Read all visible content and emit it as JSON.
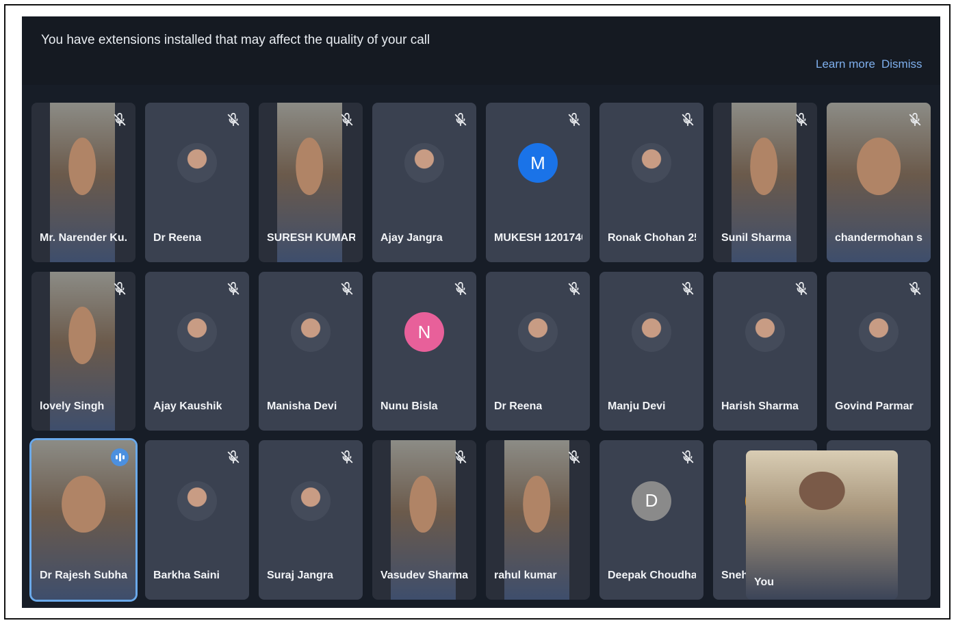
{
  "banner": {
    "message": "You have extensions installed that may affect the quality of your call",
    "learn_more": "Learn more",
    "dismiss": "Dismiss"
  },
  "participants": [
    {
      "name": "Mr. Narender Ku...",
      "type": "video"
    },
    {
      "name": "Dr Reena",
      "type": "photo"
    },
    {
      "name": "SURESH KUMAR",
      "type": "video"
    },
    {
      "name": "Ajay Jangra",
      "type": "photo"
    },
    {
      "name": "MUKESH 1201740...",
      "type": "initial",
      "initial": "M",
      "color": "#1a73e8"
    },
    {
      "name": "Ronak Chohan 25...",
      "type": "photo"
    },
    {
      "name": "Sunil Sharma",
      "type": "video"
    },
    {
      "name": "chandermohan s...",
      "type": "video"
    },
    {
      "name": "lovely Singh",
      "type": "video"
    },
    {
      "name": "Ajay Kaushik",
      "type": "photo"
    },
    {
      "name": "Manisha Devi",
      "type": "photo"
    },
    {
      "name": "Nunu Bisla",
      "type": "initial",
      "initial": "N",
      "color": "#e8609a"
    },
    {
      "name": "Dr Reena",
      "type": "photo"
    },
    {
      "name": "Manju Devi",
      "type": "photo"
    },
    {
      "name": "Harish Sharma",
      "type": "photo"
    },
    {
      "name": "Govind Parmar",
      "type": "photo"
    },
    {
      "name": "Dr Rajesh Subha...",
      "type": "video",
      "speaking": true
    },
    {
      "name": "Barkha Saini",
      "type": "photo"
    },
    {
      "name": "Suraj Jangra",
      "type": "photo"
    },
    {
      "name": "Vasudev Sharma",
      "type": "video"
    },
    {
      "name": "rahul kumar",
      "type": "video"
    },
    {
      "name": "Deepak Choudhary",
      "type": "initial",
      "initial": "D",
      "color": "#8a8a8a"
    },
    {
      "name": "Sneha Sh",
      "type": "initial",
      "initial": "",
      "color": "#e6951a"
    },
    {
      "name": "",
      "type": "blank"
    }
  ],
  "self_view": {
    "label": "You"
  },
  "icons": {
    "muted": "mic-off-icon",
    "speaking": "audio-level-icon"
  },
  "colors": {
    "accent": "#6aa9ea",
    "tile": "#3a4150"
  }
}
